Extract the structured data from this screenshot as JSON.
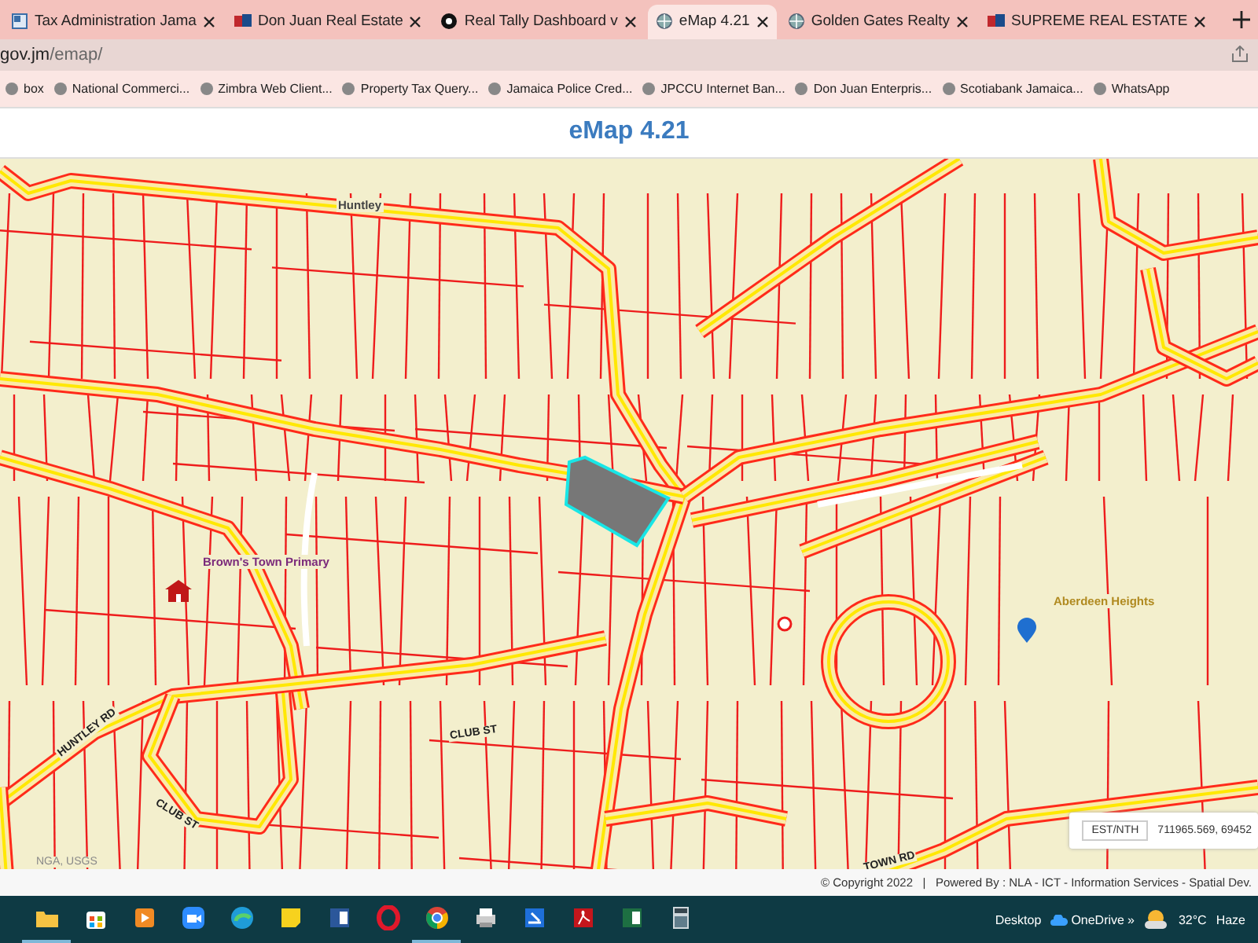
{
  "tabs": [
    {
      "label": "Tax Administration Jama",
      "kind": "document",
      "selected": false
    },
    {
      "label": "Don Juan Real Estate",
      "kind": "logo",
      "selected": false
    },
    {
      "label": "Real Tally Dashboard v",
      "kind": "dark",
      "selected": false
    },
    {
      "label": "eMap 4.21",
      "kind": "globe",
      "selected": true
    },
    {
      "label": "Golden Gates Realty",
      "kind": "globe",
      "selected": false
    },
    {
      "label": "SUPREME REAL ESTATE",
      "kind": "logo",
      "selected": false
    }
  ],
  "address": {
    "url_host": "gov.jm",
    "url_path": "/emap/"
  },
  "bookmarks": [
    "box",
    "National Commerci...",
    "Zimbra Web Client...",
    "Property Tax Query...",
    "Jamaica Police Cred...",
    "JPCCU Internet Ban...",
    "Don Juan Enterpris...",
    "Scotiabank Jamaica...",
    "WhatsApp"
  ],
  "header": {
    "title": "eMap 4.21"
  },
  "map": {
    "labels": [
      {
        "text": "Huntley",
        "kind": "place"
      },
      {
        "text": "Brown's Town Primary",
        "kind": "school"
      },
      {
        "text": "Aberdeen Heights",
        "kind": "area"
      },
      {
        "text": "HUNTLEY RD",
        "kind": "road"
      },
      {
        "text": "CLUB ST",
        "kind": "road"
      },
      {
        "text": "CLUB ST",
        "kind": "road"
      },
      {
        "text": "TOWN RD",
        "kind": "road"
      }
    ],
    "attribution": "NGA, USGS",
    "coords": {
      "button": "EST/NTH",
      "value": "711965.569, 69452"
    },
    "footer": "© Copyright 2022   |   Powered By : NLA - ICT - Information Services - Spatial Dev."
  },
  "taskbar": {
    "apps": [
      {
        "kind": "folder",
        "active": true
      },
      {
        "kind": "store",
        "active": false
      },
      {
        "kind": "media",
        "active": false
      },
      {
        "kind": "camera",
        "active": false
      },
      {
        "kind": "edge",
        "active": false
      },
      {
        "kind": "notes",
        "active": false
      },
      {
        "kind": "word",
        "active": false
      },
      {
        "kind": "opera",
        "active": false
      },
      {
        "kind": "chrome",
        "active": true
      },
      {
        "kind": "printer",
        "active": false
      },
      {
        "kind": "docs",
        "active": false
      },
      {
        "kind": "pdf",
        "active": false
      },
      {
        "kind": "excel",
        "active": false
      },
      {
        "kind": "calculator",
        "active": false
      }
    ],
    "desktop": "Desktop",
    "onedrive": "OneDrive",
    "more": "»",
    "temperature": "32°C",
    "weather": "Haze"
  }
}
